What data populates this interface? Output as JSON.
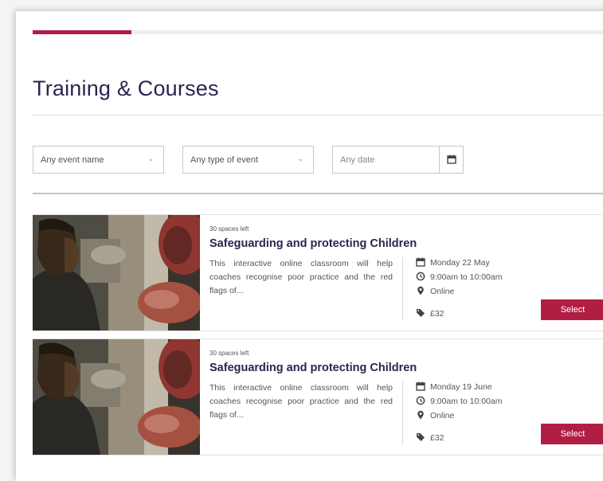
{
  "progress": {
    "fraction": 0.173
  },
  "page": {
    "title": "Training & Courses"
  },
  "filters": {
    "event_name": "Any event name",
    "event_type": "Any type of event",
    "date_placeholder": "Any date"
  },
  "icons": {
    "calendar": "calendar-icon",
    "clock": "clock-icon",
    "location": "map-pin-icon",
    "price": "tag-icon",
    "dropdown": "chevron-down-icon"
  },
  "colors": {
    "accent": "#b01e44",
    "title": "#2d2350"
  },
  "courses": [
    {
      "spaces": "30 spaces left",
      "title": "Safeguarding and protecting Children",
      "description": "This interactive online classroom will help coaches recognise poor practice and the red flags of...",
      "date": "Monday 22 May",
      "time": "9:00am to 10:00am",
      "location": "Online",
      "price": "£32",
      "button": "Select"
    },
    {
      "spaces": "30 spaces left",
      "title": "Safeguarding and protecting Children",
      "description": "This interactive online classroom will help coaches recognise poor practice and the red flags of...",
      "date": "Monday 19 June",
      "time": "9:00am to 10:00am",
      "location": "Online",
      "price": "£32",
      "button": "Select"
    }
  ]
}
